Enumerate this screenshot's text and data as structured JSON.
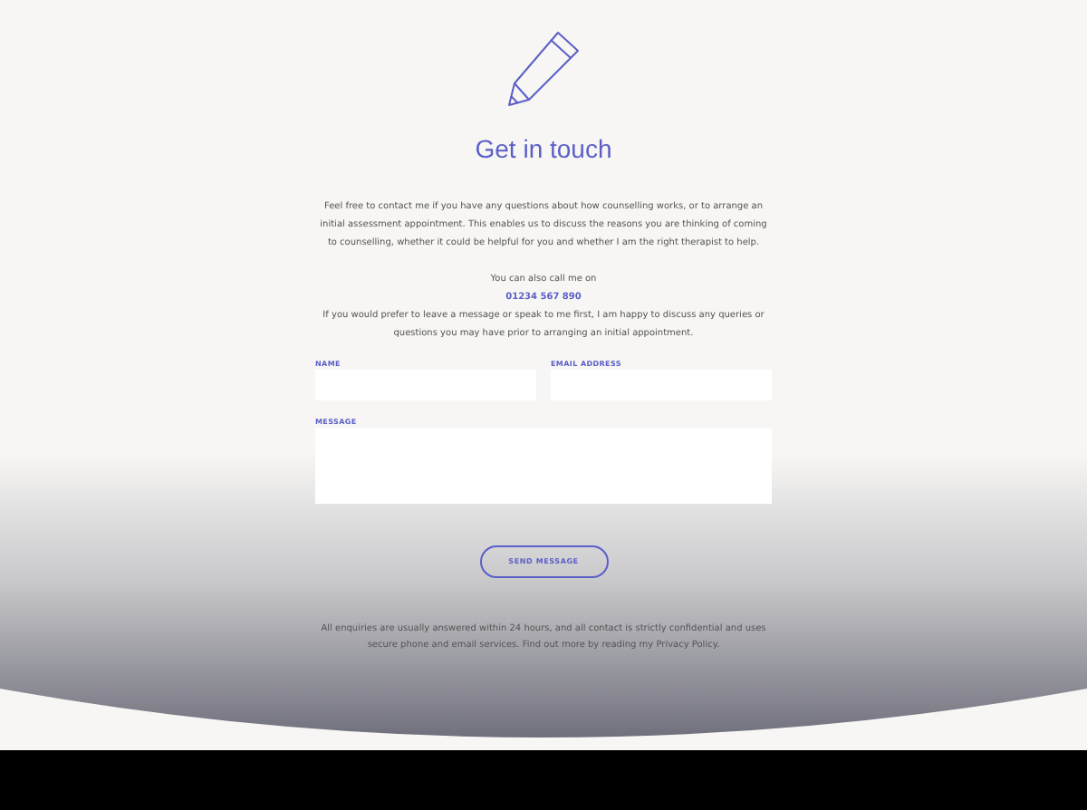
{
  "heading": "Get in touch",
  "intro": "Feel free to contact me if you have any questions about how counselling works, or to arrange an initial assessment appointment. This enables us to discuss the reasons you are thinking of coming to counselling, whether it could be helpful for you and whether I am the right therapist to help.",
  "call_label": "You can also call me on",
  "phone": "01234 567 890",
  "message_note": "If you would prefer to leave a message or speak to me first, I am happy to discuss any queries or questions you may have prior to arranging an initial appointment.",
  "fields": [
    {
      "label": "NAME",
      "kind": "input"
    },
    {
      "label": "EMAIL ADDRESS",
      "kind": "input"
    },
    {
      "label": "MESSAGE",
      "kind": "textarea"
    }
  ],
  "submit": "SEND MESSAGE",
  "footnote": "All enquiries are usually answered within 24 hours, and all contact is strictly confidential and uses secure phone and email services. Find out more by reading my Privacy Policy."
}
